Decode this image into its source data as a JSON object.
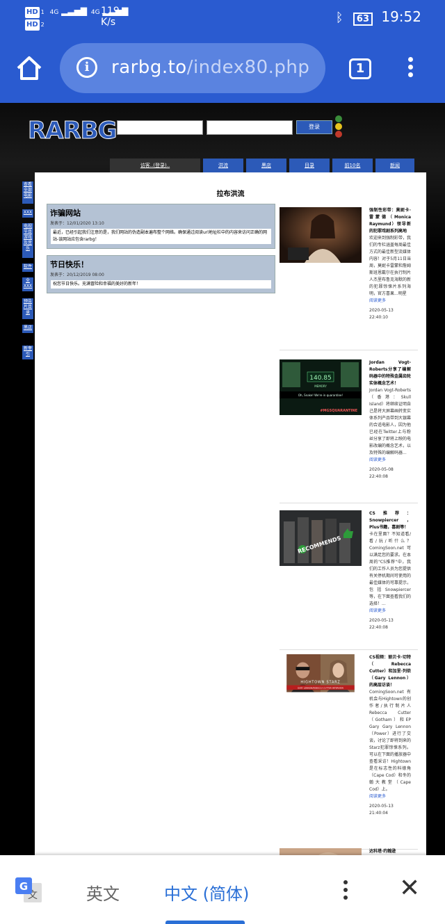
{
  "status": {
    "hd1": "HD",
    "hd1_sub": "1",
    "hd2": "HD",
    "hd2_sub": "2",
    "net1": "4G",
    "net2": "4G",
    "speed_value": "119",
    "speed_unit": "K/s",
    "battery": "63",
    "time": "19:52"
  },
  "browser": {
    "url_domain": "rarbg.to",
    "url_path": "/index80.php",
    "tab_count": "1"
  },
  "site": {
    "logo": "RARBG",
    "login_button": "登录",
    "nav": [
      "访客..(登录)..",
      "洪流",
      "黑店",
      "目录",
      "前10名",
      "新闻"
    ],
    "side": [
      "查看全部电影",
      "XXX",
      "电视节目游戏及音乐",
      "软件",
      "全XXX",
      "预告片目录",
      "黑店",
      "新奎引"
    ],
    "page_title": "拉布洪流"
  },
  "news": [
    {
      "title": "诈骗网站",
      "date": "发表于：12/01/2020 13:10",
      "body": "最近，已经引起我们注意的是，我们网站的伪造副本遍布整个网络。确保通过阅读url地址栏中的内容来访问正确的网站-该网站应包含rarbg！"
    },
    {
      "title": "节日快乐！",
      "date": "发表于：20/12/2019 08:00",
      "body": "祝您节日快乐。充满冒险和幸福的美好的新年！"
    }
  ],
  "articles": [
    {
      "title": "强制性彩带：莫妮卡·雷蒙德（Monica Raymund）领导新的犯罪戏剧系列高地",
      "body": "欢迎来到强制彩带，我们的专栏涵盖每周最佳方式的最佳新型流媒体内容！对于5月11日当周，莫妮卡雷蒙和詹姆斯班恩戴尔在执行制片人杰里布鲁克海默的新的犯罪惊悚片系列海明，官方喜果...明星",
      "more": "阅读更多",
      "time": "2020-05-13 22:40:10"
    },
    {
      "title": "Jordan Vogt-Roberts分享了编解码器中的特殊金属齿轮实体概念艺术！",
      "body": "Jordan Vogt-Roberts（香港：Skull Island）将继续证明自己是将大屏幕画转变实体系列产品带到大银幕的合适电影人，因为他已经在Twitter上与粉丝分享了即将上映的电影改编的概念艺术，以及特殊的编解码器...",
      "more": "阅读更多",
      "time": "2020-05-08 22:40:08"
    },
    {
      "title": "CS推荐：Snowpiercer，Plus书籍，喜剧等！",
      "body": "卡在里面？不知道看/看/玩/听什么？ComingSoon.net可以满足您的要求。在本周的\"CS推荐\"中，我们的工作人员为您提供有关停机期间可使用的最佳媒体的可靠提示，包括Snowpiercer等，在下面查看我们的选择！...",
      "more": "阅读更多",
      "time": "2020-05-13 22:40:08"
    },
    {
      "title": "CS视频：丽贝卡·切特（Rebecca Cutter）和加里·列侬（Gary Lennon）的高层访谈！",
      "body": "ComingSoon.net有机会与Hightown的创作者/执行制片人Rebecca Cutter（Gotham）和EP Gary Gary Lennon（Power）进行了交谈，讨论了即将到来的Starz犯罪惊悚系列。可以在下面的播放器中查看采访！Hightown是在标志性的科德角（Cape Cod）和冬的翰大教堂（Cape Cod）上。",
      "more": "阅读更多",
      "time": "2020-05-13 21:40:04"
    },
    {
      "title": "达科塔·约翰逊",
      "body": "",
      "more": "",
      "time": ""
    }
  ],
  "thumbs": [
    "woman-laptop-still",
    "codec-game-still",
    "cs-recommends-still",
    "hightown-interview-still",
    "partial-still"
  ],
  "thumb_text": {
    "codec_value": "140.85",
    "codec_label": "MEMORY",
    "codec_caption": "Oh, Snake! We're in quarantine!",
    "codec_tag": "#MGSQUARANTINE",
    "cs_badge": "RECOMMENDS",
    "hightown_logo": "HIGHTOWN STARZ",
    "hightown_names": "GARY LENNON/REBECCA CUTTER INTERVIEW"
  },
  "translate": {
    "source_lang": "英文",
    "target_lang": "中文 (简体)"
  },
  "colors": {
    "browser_blue": "#2a5bd0",
    "site_blue": "#2c5ab8",
    "news_box": "#b4c2d4",
    "translate_accent": "#2a6fd6"
  }
}
